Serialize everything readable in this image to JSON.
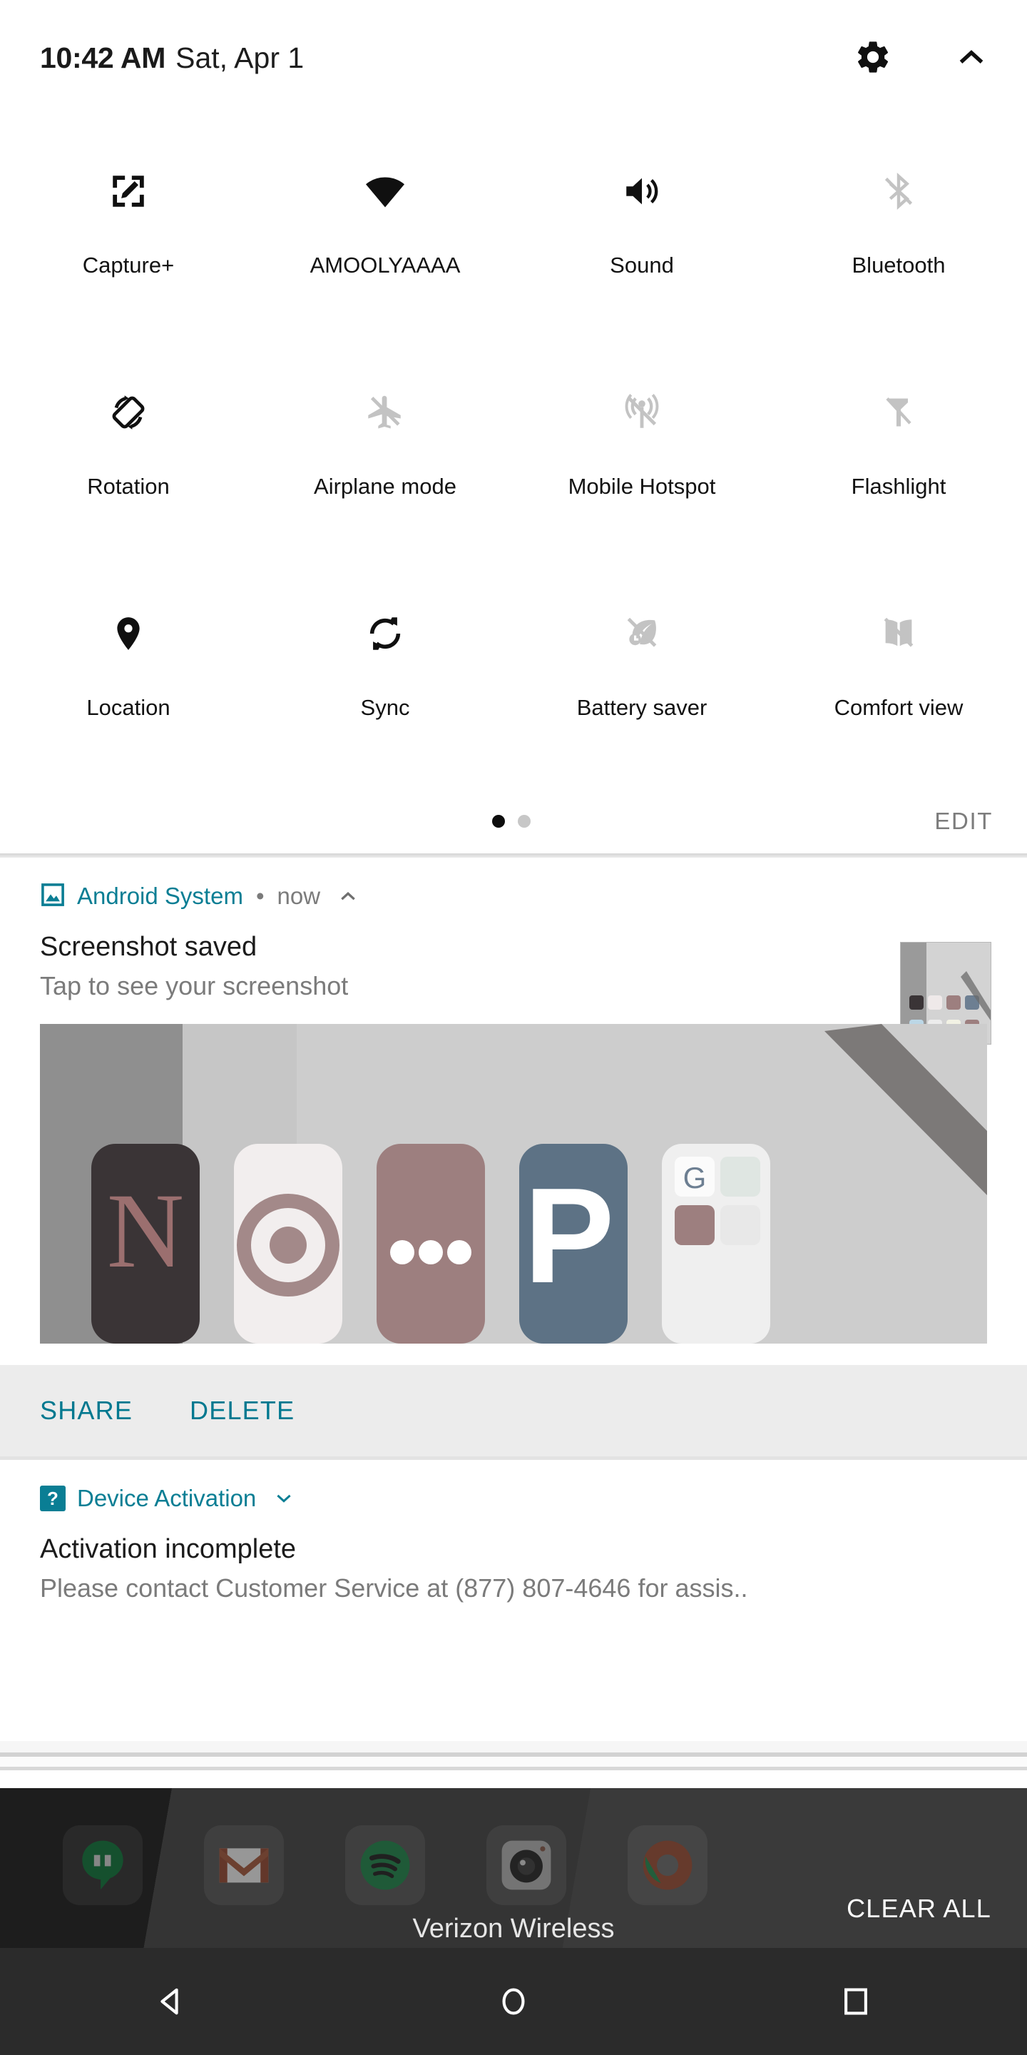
{
  "status_bar": {
    "time": "10:42 AM",
    "date": "Sat, Apr 1",
    "settings_icon": "gear-icon",
    "collapse_icon": "chevron-up-icon"
  },
  "quick_settings": {
    "tiles": [
      {
        "label": "Capture+",
        "icon": "capture-plus-icon",
        "enabled": true
      },
      {
        "label": "AMOOLYAAAA",
        "icon": "wifi-icon",
        "enabled": true
      },
      {
        "label": "Sound",
        "icon": "sound-icon",
        "enabled": true
      },
      {
        "label": "Bluetooth",
        "icon": "bluetooth-off-icon",
        "enabled": false
      },
      {
        "label": "Rotation",
        "icon": "rotation-icon",
        "enabled": true
      },
      {
        "label": "Airplane mode",
        "icon": "airplane-off-icon",
        "enabled": false
      },
      {
        "label": "Mobile Hotspot",
        "icon": "hotspot-off-icon",
        "enabled": false
      },
      {
        "label": "Flashlight",
        "icon": "flashlight-off-icon",
        "enabled": false
      },
      {
        "label": "Location",
        "icon": "location-pin-icon",
        "enabled": true
      },
      {
        "label": "Sync",
        "icon": "sync-icon",
        "enabled": true
      },
      {
        "label": "Battery saver",
        "icon": "battery-saver-off-icon",
        "enabled": false
      },
      {
        "label": "Comfort view",
        "icon": "comfort-view-off-icon",
        "enabled": false
      }
    ],
    "pages": 2,
    "active_page": 1,
    "edit_label": "EDIT"
  },
  "notifications": [
    {
      "app_name": "Android System",
      "app_icon": "image-icon",
      "separator": "•",
      "time": "now",
      "expand_icon": "chevron-up-icon",
      "title": "Screenshot saved",
      "body": "Tap to see your screenshot",
      "thumbnail": "screenshot-thumbnail",
      "preview": "screenshot-preview",
      "actions": [
        "SHARE",
        "DELETE"
      ]
    },
    {
      "app_name": "Device Activation",
      "app_icon": "question-badge-icon",
      "expand_icon": "chevron-down-icon",
      "title": "Activation incomplete",
      "body": "Please contact Customer Service at (877) 807-4646 for assis.."
    }
  ],
  "shade_footer": {
    "carrier": "Verizon Wireless",
    "clear_all_label": "CLEAR ALL"
  },
  "nav_bar": {
    "back": "back-triangle-icon",
    "home": "home-circle-icon",
    "recents": "recents-square-icon"
  },
  "colors": {
    "accent_teal": "#0a7e94",
    "action_teal": "#00788f",
    "icon_active": "#101010",
    "icon_disabled": "#c3c3c3",
    "secondary_text": "#7b7b7b",
    "panel_bg": "#ffffff",
    "action_bar_bg": "#ececec",
    "navbar_bg": "#2b2b2b"
  }
}
